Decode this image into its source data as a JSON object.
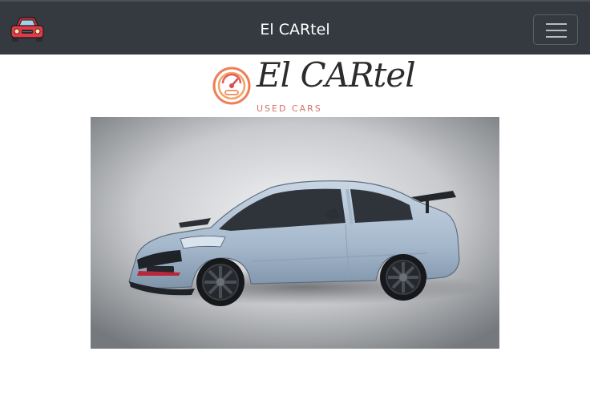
{
  "navbar": {
    "title": "El CARtel",
    "brand_icon": "red-car-icon",
    "toggler_icon": "hamburger-menu-icon",
    "background": "#343a40"
  },
  "logo": {
    "script_text": "El CARtel",
    "subtitle": "USED CARS",
    "icon": "speedometer-icon",
    "accent_color": "#ec8a5a"
  },
  "hero": {
    "image": "car-photo",
    "car_color": "#a9bdd2"
  }
}
